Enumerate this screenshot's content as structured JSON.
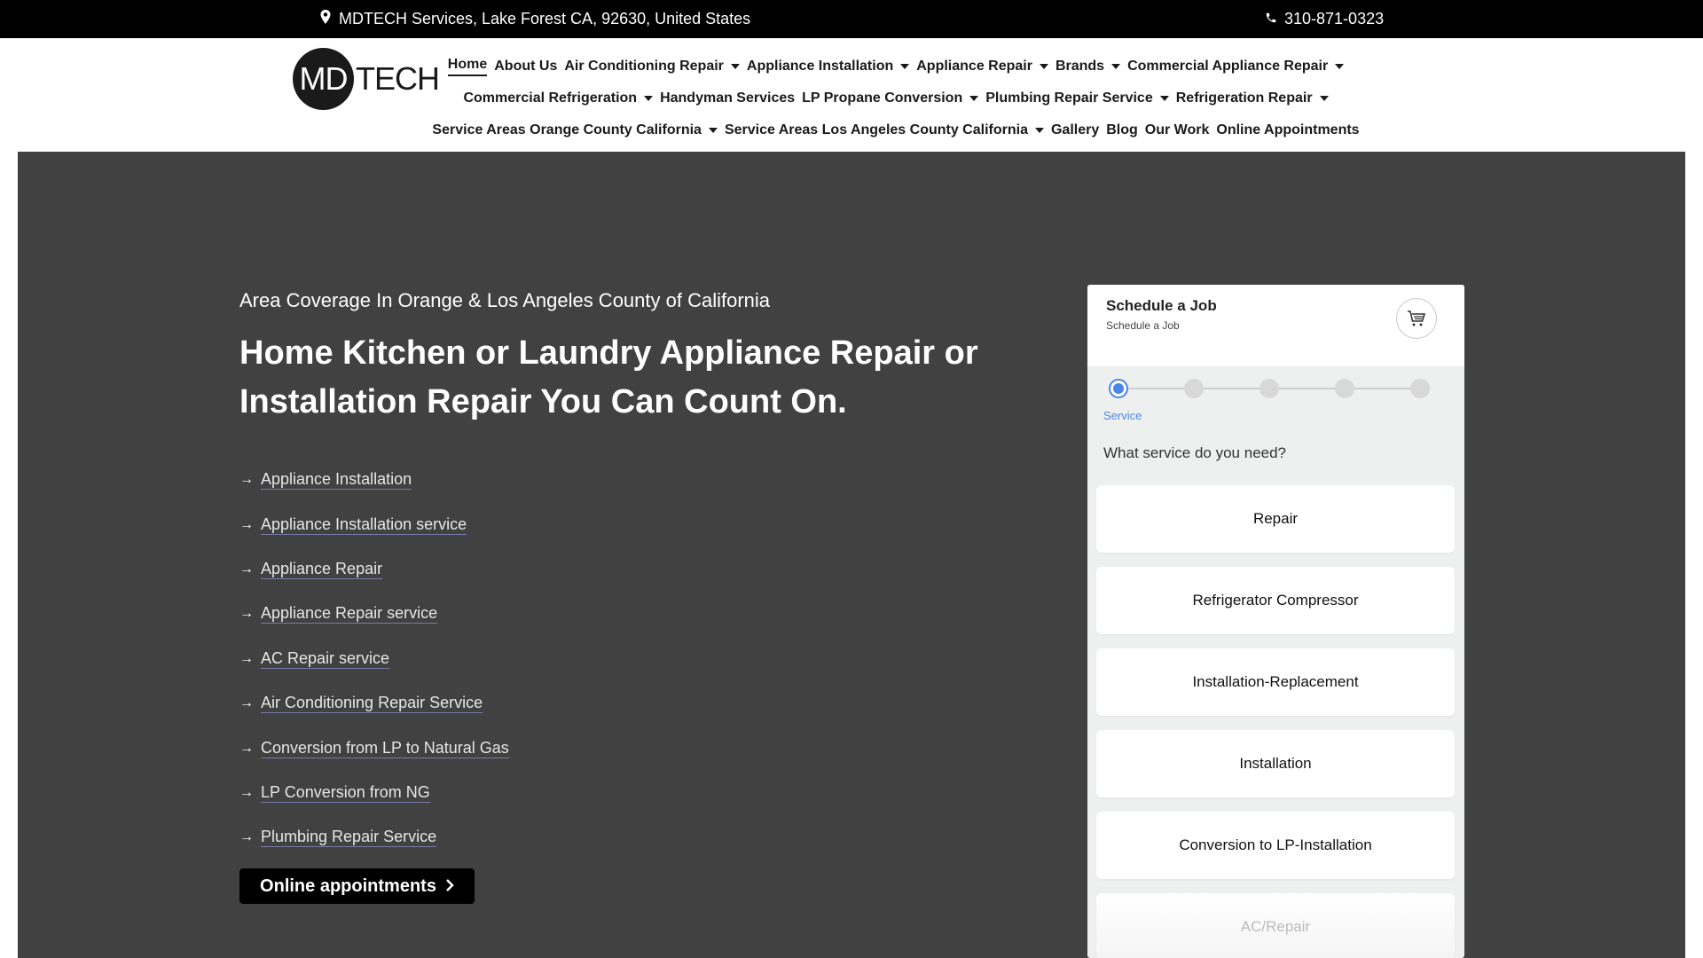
{
  "topbar": {
    "address": "MDTECH Services, Lake Forest CA, 92630, United States",
    "address_icon": "map-pin-icon",
    "phone": "310-871-0323",
    "phone_icon": "phone-icon"
  },
  "logo": {
    "circle_text": "MD",
    "rest_text": "TECH"
  },
  "nav": {
    "row1": [
      {
        "label": "Home",
        "dropdown": false,
        "active": true
      },
      {
        "label": "About Us",
        "dropdown": false
      },
      {
        "label": "Air Conditioning Repair",
        "dropdown": true
      },
      {
        "label": "Appliance Installation",
        "dropdown": true
      },
      {
        "label": "Appliance Repair",
        "dropdown": true
      },
      {
        "label": "Brands",
        "dropdown": true
      },
      {
        "label": "Commercial Appliance Repair",
        "dropdown": true
      }
    ],
    "row2": [
      {
        "label": "Commercial Refrigeration",
        "dropdown": true
      },
      {
        "label": "Handyman Services",
        "dropdown": false
      },
      {
        "label": "LP Propane Conversion",
        "dropdown": true
      },
      {
        "label": "Plumbing Repair Service",
        "dropdown": true
      },
      {
        "label": "Refrigeration Repair",
        "dropdown": true
      }
    ],
    "row3": [
      {
        "label": "Service Areas Orange County California",
        "dropdown": true
      },
      {
        "label": "Service Areas Los Angeles County California",
        "dropdown": true
      },
      {
        "label": "Gallery",
        "dropdown": false
      },
      {
        "label": "Blog",
        "dropdown": false
      },
      {
        "label": "Our Work",
        "dropdown": false
      },
      {
        "label": "Online Appointments",
        "dropdown": false
      }
    ]
  },
  "hero": {
    "subtitle": "Area Coverage In Orange & Los Angeles County of California",
    "headline": "Home Kitchen or Laundry Appliance Repair or Installation Repair You Can Count On.",
    "links": [
      "Appliance Installation",
      "Appliance Installation service",
      "Appliance Repair",
      "Appliance Repair service",
      "AC Repair service",
      "Air Conditioning Repair Service",
      "Conversion from LP to Natural Gas",
      "LP Conversion from NG",
      "Plumbing Repair Service"
    ],
    "cta_label": "Online appointments"
  },
  "widget": {
    "title": "Schedule a Job",
    "subtitle": "Schedule a Job",
    "cart_icon": "cart-icon",
    "step_label": "Service",
    "step_count": 5,
    "active_step": 1,
    "question": "What service do you need?",
    "options": [
      "Repair",
      "Refrigerator Compressor",
      "Installation-Replacement",
      "Installation",
      "Conversion to LP-Installation",
      "AC/Repair"
    ]
  },
  "colors": {
    "topbar_bg": "#000000",
    "hero_bg": "#414141",
    "accent_blue": "#4a86e8",
    "widget_bg": "#eef0f0"
  }
}
